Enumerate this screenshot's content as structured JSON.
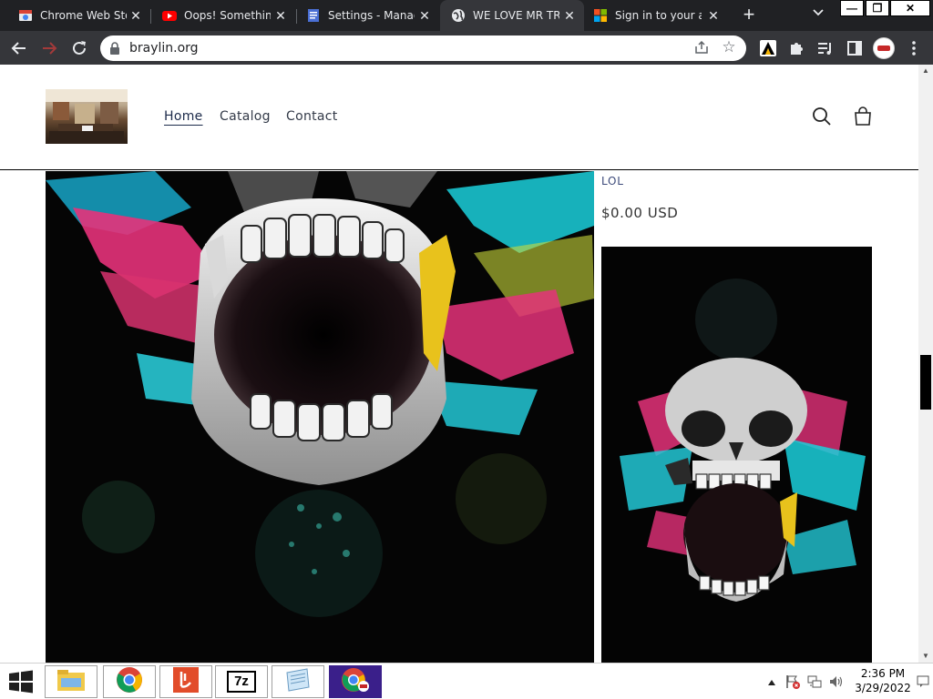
{
  "browser": {
    "tabs": [
      {
        "title": "Chrome Web Store",
        "icon": "chrome-web-store-icon",
        "active": false
      },
      {
        "title": "Oops! Something",
        "icon": "youtube-icon",
        "active": false
      },
      {
        "title": "Settings - Manage",
        "icon": "settings-doc-icon",
        "active": false
      },
      {
        "title": "WE LOVE MR TRA",
        "icon": "globe-icon",
        "active": true
      },
      {
        "title": "Sign in to your ac",
        "icon": "microsoft-icon",
        "active": false
      }
    ],
    "new_tab_symbol": "+",
    "tab_close_symbol": "✕",
    "window_buttons": {
      "minimize": "—",
      "restore": "❐",
      "close": "✕"
    },
    "address": "braylin.org"
  },
  "site": {
    "nav": [
      {
        "label": "Home",
        "current": true
      },
      {
        "label": "Catalog",
        "current": false
      },
      {
        "label": "Contact",
        "current": false
      }
    ],
    "product": {
      "vendor": "LOL",
      "price": "$0.00 USD"
    }
  },
  "taskbar": {
    "apps": [
      "file-explorer-icon",
      "chrome-icon",
      "adobe-reader-icon",
      "7zip-icon",
      "notepad-icon",
      "chrome-profile-icon"
    ],
    "seven_zip_label": "7z",
    "time": "2:36 PM",
    "date": "3/29/2022"
  },
  "colors": {
    "tabstrip": "#202124",
    "toolbar": "#35363a",
    "nav_text": "#333a48",
    "vendor_text": "#3c4a7a",
    "active_taskbar": "#3a1f8a"
  }
}
